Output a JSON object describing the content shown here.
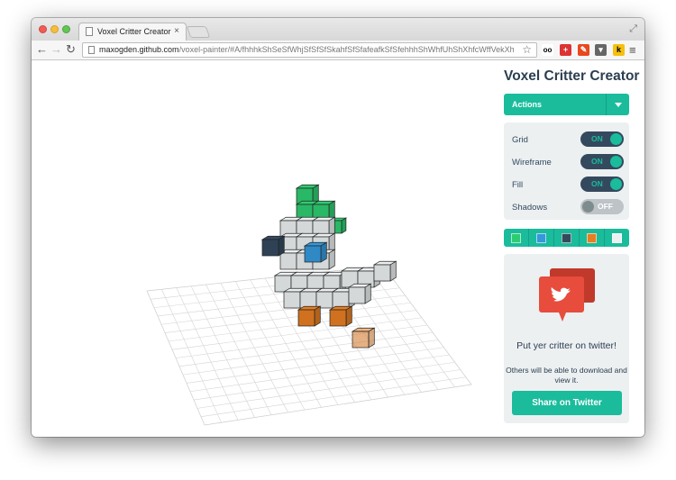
{
  "browser": {
    "tab_title": "Voxel Critter Creator",
    "tab_close": "×",
    "url_host": "maxogden.github.com",
    "url_path": "/voxel-painter/#A/fhhhkShSeSfWhjSfSfSfSkahfSfSfafeafkSfSfehhhShWhfUhShXhfcWffVekXhidTh...",
    "nav_back": "←",
    "nav_forward": "→",
    "nav_reload": "↻",
    "star": "☆",
    "menu": "≡",
    "fullscreen": "⤢",
    "extensions": [
      "oo",
      "+",
      "✎",
      "▾",
      "k"
    ]
  },
  "app": {
    "title": "Voxel Critter Creator",
    "actions_label": "Actions",
    "settings": [
      {
        "label": "Grid",
        "state": "ON"
      },
      {
        "label": "Wireframe",
        "state": "ON"
      },
      {
        "label": "Fill",
        "state": "ON"
      },
      {
        "label": "Shadows",
        "state": "OFF"
      }
    ],
    "palette_colors": [
      "#2ecc71",
      "#3498db",
      "#34495e",
      "#e67e22",
      "#ecf0f1"
    ],
    "share": {
      "heading": "Put yer critter on twitter!",
      "text": "Others will be able to download and view it.",
      "button": "Share on Twitter"
    }
  },
  "colors": {
    "accent": "#1abc9c",
    "dark": "#34495e",
    "twitter_red": "#e74c3c"
  }
}
